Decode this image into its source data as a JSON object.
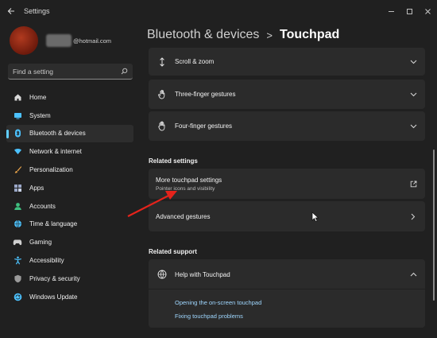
{
  "window": {
    "title": "Settings",
    "back_icon": "back-arrow-icon",
    "controls": [
      "minimize",
      "maximize",
      "close"
    ]
  },
  "profile": {
    "email_suffix": "@hotmail.com"
  },
  "search": {
    "placeholder": "Find a setting"
  },
  "sidebar": {
    "items": [
      {
        "label": "Home",
        "icon": "home-icon",
        "color": "#d9d9d9"
      },
      {
        "label": "System",
        "icon": "system-icon",
        "color": "#4cc2ff"
      },
      {
        "label": "Bluetooth & devices",
        "icon": "bluetooth-icon",
        "color": "#4cc2ff",
        "active": true
      },
      {
        "label": "Network & internet",
        "icon": "network-icon",
        "color": "#4cc2ff"
      },
      {
        "label": "Personalization",
        "icon": "brush-icon",
        "color": "#e8a34a"
      },
      {
        "label": "Apps",
        "icon": "apps-icon",
        "color": "#9aa7c7"
      },
      {
        "label": "Accounts",
        "icon": "accounts-icon",
        "color": "#3fbf7f"
      },
      {
        "label": "Time & language",
        "icon": "globe-icon",
        "color": "#4cc2ff"
      },
      {
        "label": "Gaming",
        "icon": "gaming-icon",
        "color": "#cfcfcf"
      },
      {
        "label": "Accessibility",
        "icon": "accessibility-icon",
        "color": "#4cc2ff"
      },
      {
        "label": "Privacy & security",
        "icon": "shield-icon",
        "color": "#9a9a9a"
      },
      {
        "label": "Windows Update",
        "icon": "update-icon",
        "color": "#4cc2ff"
      }
    ]
  },
  "breadcrumb": {
    "parent": "Bluetooth & devices",
    "separator": ">",
    "current": "Touchpad"
  },
  "gestures": {
    "items": [
      {
        "label": "Scroll & zoom",
        "icon": "scroll-icon"
      },
      {
        "label": "Three-finger gestures",
        "icon": "hand-icon"
      },
      {
        "label": "Four-finger gestures",
        "icon": "hand-icon"
      }
    ]
  },
  "related_settings": {
    "title": "Related settings",
    "more": {
      "label": "More touchpad settings",
      "sub": "Pointer icons and visibility",
      "icon": "open-external-icon"
    },
    "advanced": {
      "label": "Advanced gestures"
    }
  },
  "related_support": {
    "title": "Related support",
    "help": {
      "label": "Help with Touchpad",
      "icon": "globe-icon"
    },
    "links": [
      "Opening the on-screen touchpad",
      "Fixing touchpad problems"
    ]
  },
  "colors": {
    "accent": "#60cdff",
    "link": "#9fd7ff",
    "annotation_arrow": "#e5231b"
  }
}
